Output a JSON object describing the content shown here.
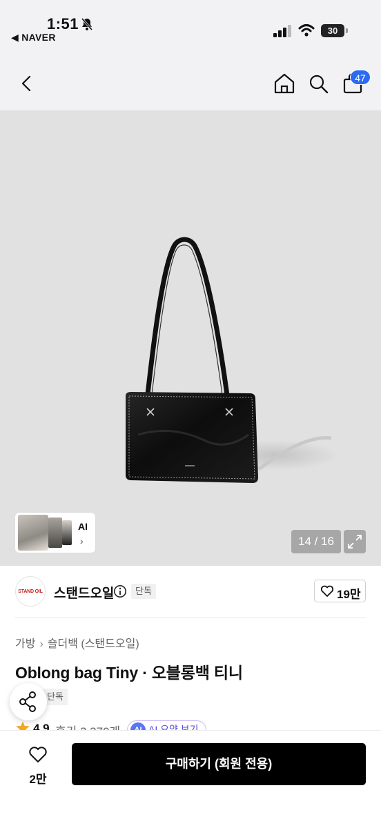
{
  "status_bar": {
    "time": "1:51",
    "back_app": "◀ NAVER",
    "battery": "30"
  },
  "nav": {
    "cart_count": "47"
  },
  "gallery": {
    "thumb_ai_label": "AI",
    "thumb_chevron": "›",
    "counter": "14 / 16"
  },
  "brand": {
    "logo_text": "STAND OIL",
    "name": "스탠드오일",
    "tag": "단독",
    "likes": "19만"
  },
  "product": {
    "breadcrumb": [
      "가방",
      "숄더백 (스탠드오일)"
    ],
    "breadcrumb_sep": "›",
    "title": "Oblong bag Tiny · 오블롱백 티니",
    "tag": "단독",
    "rating": "4.9",
    "reviews": "후기 3,379개",
    "ai_badge": "AI",
    "ai_summary": "AI 요약 보기"
  },
  "bottom": {
    "wish_count": "2만",
    "buy_label": "구매하기 (회원 전용)"
  },
  "colors": {
    "accent_blue": "#2a6bf2",
    "buy_button": "#000000",
    "ai_purple": "#5a4ad6",
    "star": "#f5a623",
    "brand_red": "#c8231f"
  }
}
